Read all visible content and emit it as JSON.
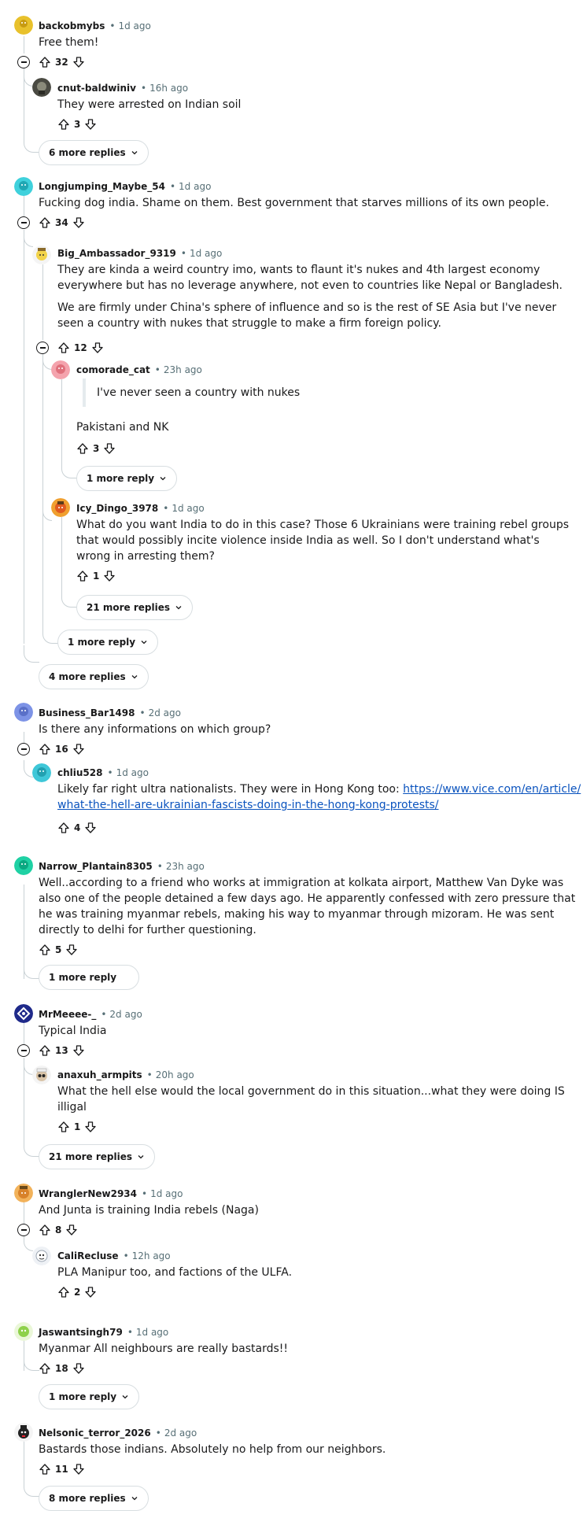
{
  "comments": [
    {
      "author": "backobmybs",
      "time": "1d ago",
      "body": "Free them!",
      "votes": "32"
    },
    {
      "author": "cnut-baldwiniv",
      "time": "16h ago",
      "body": "They were arrested on Indian soil",
      "votes": "3"
    },
    {
      "author": "Longjumping_Maybe_54",
      "time": "1d ago",
      "body": "Fucking dog india. Shame on them. Best government that starves millions of its own people.",
      "votes": "34"
    },
    {
      "author": "Big_Ambassador_9319",
      "time": "1d ago",
      "body_p1": "They are kinda a weird country imo, wants to flaunt it's nukes and 4th largest economy everywhere but has no leverage anywhere, not even to countries like Nepal or Bangladesh.",
      "body_p2": "We are firmly under China's sphere of influence and so is the rest of SE Asia but I've never seen a country with nukes that struggle to make a firm foreign policy.",
      "votes": "12"
    },
    {
      "author": "comorade_cat",
      "time": "23h ago",
      "quote": "I've never seen a country with nukes",
      "body": "Pakistani and NK",
      "votes": "3"
    },
    {
      "author": "Icy_Dingo_3978",
      "time": "1d ago",
      "body": "What do you want India to do in this case? Those 6 Ukrainians were training rebel groups that would possibly incite violence inside India as well. So I don't understand what's wrong in arresting them?",
      "votes": "1"
    },
    {
      "author": "Business_Bar1498",
      "time": "2d ago",
      "body": "Is there any informations on which group?",
      "votes": "16"
    },
    {
      "author": "chliu528",
      "time": "1d ago",
      "body_text": "Likely far right ultra nationalists. They were in Hong Kong too: ",
      "link": "https://www.vice.com/en/article/what-the-hell-are-ukrainian-fascists-doing-in-the-hong-kong-protests/",
      "votes": "4"
    },
    {
      "author": "Narrow_Plantain8305",
      "time": "23h ago",
      "body": "Well..according to a friend who works at immigration at kolkata airport, Matthew Van Dyke was also one of the people detained a few days ago. He apparently confessed with zero pressure that he was training myanmar rebels, making his way to myanmar through mizoram. He was sent directly to delhi for further questioning.",
      "votes": "5"
    },
    {
      "author": "MrMeeee-_",
      "time": "2d ago",
      "body": "Typical India",
      "votes": "13"
    },
    {
      "author": "anaxuh_armpits",
      "time": "20h ago",
      "body": "What the hell else would the local government do in this situation...what they were doing IS illigal",
      "votes": "1"
    },
    {
      "author": "WranglerNew2934",
      "time": "1d ago",
      "body": "And Junta is training India rebels (Naga)",
      "votes": "8"
    },
    {
      "author": "CaliRecluse",
      "time": "12h ago",
      "body": "PLA Manipur too, and factions of the ULFA.",
      "votes": "2"
    },
    {
      "author": "Jaswantsingh79",
      "time": "1d ago",
      "body": "Myanmar All neighbours are really bastards!!",
      "votes": "18"
    },
    {
      "author": "Nelsonic_terror_2026",
      "time": "2d ago",
      "body": "Bastards those indians. Absolutely no help from our neighbors.",
      "votes": "11"
    }
  ],
  "more": {
    "m1": "6 more replies",
    "m2": "1 more reply",
    "m3": "21 more replies",
    "m4": "1 more reply",
    "m5": "4 more replies",
    "m6": "1 more reply",
    "m7": "21 more replies",
    "m8": "1 more reply",
    "m9": "8 more replies"
  },
  "icons": {
    "upvote": "arrow-up-outline-icon",
    "downvote": "arrow-down-outline-icon",
    "collapse": "minus-circle-icon",
    "expand": "chevron-down-icon"
  },
  "colors": {
    "link": "#0a53be",
    "meta": "#576f76",
    "thread_line": "#c9d1d5"
  }
}
